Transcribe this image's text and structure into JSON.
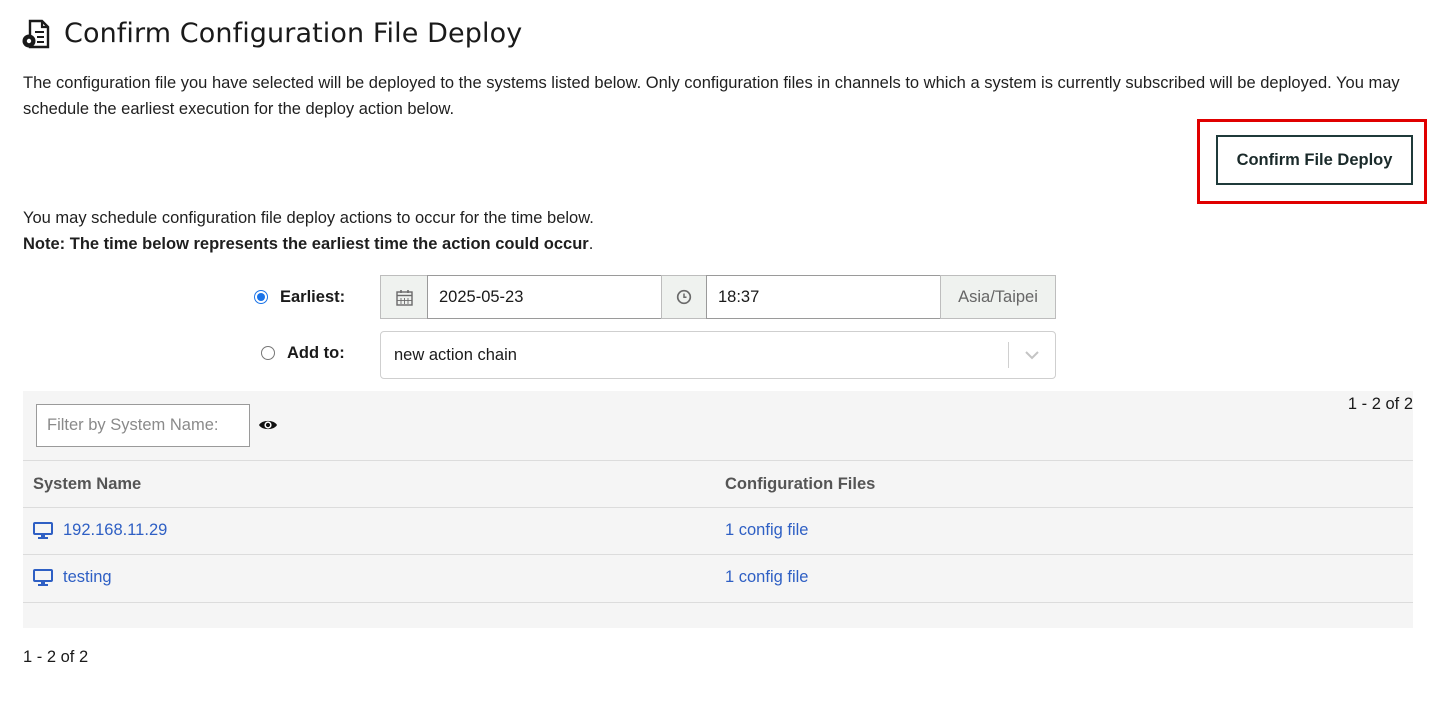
{
  "page": {
    "title": "Confirm Configuration File Deploy",
    "title_icon": "config-file-gear-icon",
    "intro": "The configuration file you have selected will be deployed to the systems listed below. Only configuration files in channels to which a system is currently subscribed will be deployed. You may schedule the earliest execution for the deploy action below."
  },
  "actions": {
    "confirm_label": "Confirm File Deploy"
  },
  "schedule": {
    "text": "You may schedule configuration file deploy actions to occur for the time below.",
    "note": "Note: The time below represents the earliest time the action could occur",
    "note_suffix": ".",
    "earliest_label": "Earliest:",
    "date": "2025-05-23",
    "time": "18:37",
    "timezone": "Asia/Taipei",
    "addto_label": "Add to:",
    "action_chain": "new action chain",
    "selected": "earliest"
  },
  "list": {
    "filter_placeholder": "Filter by System Name:",
    "count_top": "1 - 2 of 2",
    "count_bottom": "1 - 2 of 2",
    "columns": [
      "System Name",
      "Configuration Files"
    ],
    "rows": [
      {
        "system": "192.168.11.29",
        "files": "1 config file"
      },
      {
        "system": "testing",
        "files": "1 config file"
      }
    ]
  },
  "colors": {
    "link": "#2e5fc4",
    "highlight": "#e00000",
    "radio": "#1a73e8"
  }
}
